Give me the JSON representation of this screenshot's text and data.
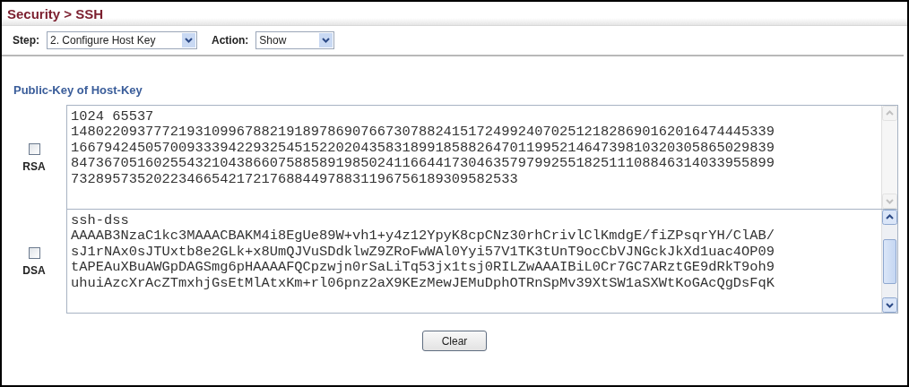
{
  "page_title": "Security > SSH",
  "toolbar": {
    "step_label": "Step:",
    "step_value": "2. Configure Host Key",
    "action_label": "Action:",
    "action_value": "Show"
  },
  "section_title": "Public-Key of Host-Key",
  "keys": [
    {
      "label": "RSA",
      "checked": false,
      "scrollbar_enabled": false,
      "lines": [
        "1024 65537",
        "1480220937772193109967882191897869076673078824151724992407025121828690162016474445339",
        "1667942450570093339422932545152202043583189918588264701199521464739810320305865029839",
        "8473670516025543210438660758858919850241166441730463579799255182511108846314033955899",
        "732895735202234665421721768844978831196756189309582533"
      ]
    },
    {
      "label": "DSA",
      "checked": false,
      "scrollbar_enabled": true,
      "lines": [
        "ssh-dss",
        "AAAAB3NzaC1kc3MAAACBAKM4i8EgUe89W+vh1+y4z12YpyK8cpCNz30rhCrivlClKmdgE/fiZPsqrYH/ClAB/",
        "sJ1rNAx0sJTUxtb8e2GLk+x8UmQJVuSDdklwZ9ZRoFwWAl0Yyi57V1TK3tUnT9ocCbVJNGckJkXd1uac4OP09",
        "tAPEAuXBuAWGpDAGSmg6pHAAAAFQCpzwjn0rSaLiTq53jx1tsj0RILZwAAAIBiL0Cr7GC7ARztGE9dRkT9oh9",
        "uhuiAzcXrAcZTmxhjGsEtMlAtxKm+rl06pnz2aX9KEzMewJEMuDphOTRnSpMv39XtSW1aSXWtKoGAcQgDsFqK"
      ]
    }
  ],
  "clear_button": "Clear"
}
